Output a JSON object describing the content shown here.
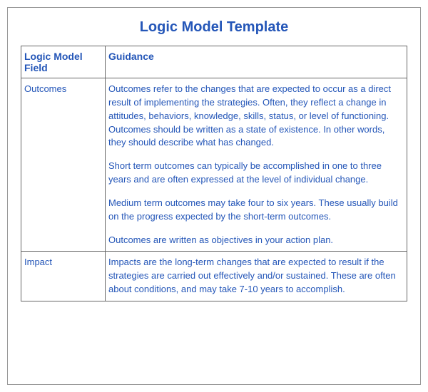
{
  "title": "Logic Model Template",
  "headers": {
    "field": "Logic Model Field",
    "guidance": "Guidance"
  },
  "rows": [
    {
      "field": "Outcomes",
      "guidance": [
        "Outcomes refer to the changes that are expected to occur as a direct result of implementing the strategies. Often, they reflect a change in attitudes, behaviors, knowledge, skills, status, or level of functioning. Outcomes should be written as a state of existence.  In other words, they should describe what has changed.",
        "Short term outcomes can typically be accomplished in one to three years and are often expressed at the level of individual change.",
        "Medium term outcomes may take four to six years.  These usually build on the progress expected by the short-term outcomes.",
        "Outcomes are written as objectives in your action plan."
      ]
    },
    {
      "field": "Impact",
      "guidance": [
        "Impacts are the long-term changes that are expected to result if the strategies are carried out effectively and/or sustained.  These are often about conditions, and may take 7-10 years to accomplish."
      ]
    }
  ]
}
